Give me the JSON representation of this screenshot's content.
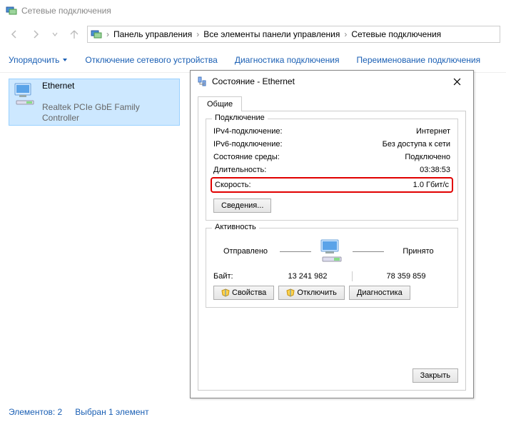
{
  "window": {
    "title": "Сетевые подключения"
  },
  "breadcrumb": {
    "p1": "Панель управления",
    "p2": "Все элементы панели управления",
    "p3": "Сетевые подключения"
  },
  "toolbar": {
    "organize": "Упорядочить",
    "disable": "Отключение сетевого устройства",
    "diagnose": "Диагностика подключения",
    "rename": "Переименование подключения"
  },
  "adapter": {
    "name": "Ethernet",
    "desc": "Realtek PCIe GbE Family Controller"
  },
  "status": {
    "count": "Элементов: 2",
    "selected": "Выбран 1 элемент"
  },
  "dialog": {
    "title": "Состояние - Ethernet",
    "tab_general": "Общие",
    "group_conn": "Подключение",
    "ipv4_k": "IPv4-подключение:",
    "ipv4_v": "Интернет",
    "ipv6_k": "IPv6-подключение:",
    "ipv6_v": "Без доступа к сети",
    "media_k": "Состояние среды:",
    "media_v": "Подключено",
    "dur_k": "Длительность:",
    "dur_v": "03:38:53",
    "speed_k": "Скорость:",
    "speed_v": "1.0 Гбит/с",
    "details_btn": "Сведения...",
    "group_act": "Активность",
    "sent": "Отправлено",
    "recv": "Принято",
    "bytes_label": "Байт:",
    "bytes_sent": "13 241 982",
    "bytes_recv": "78 359 859",
    "props_btn": "Свойства",
    "disable_btn": "Отключить",
    "diag_btn": "Диагностика",
    "close_btn": "Закрыть"
  }
}
